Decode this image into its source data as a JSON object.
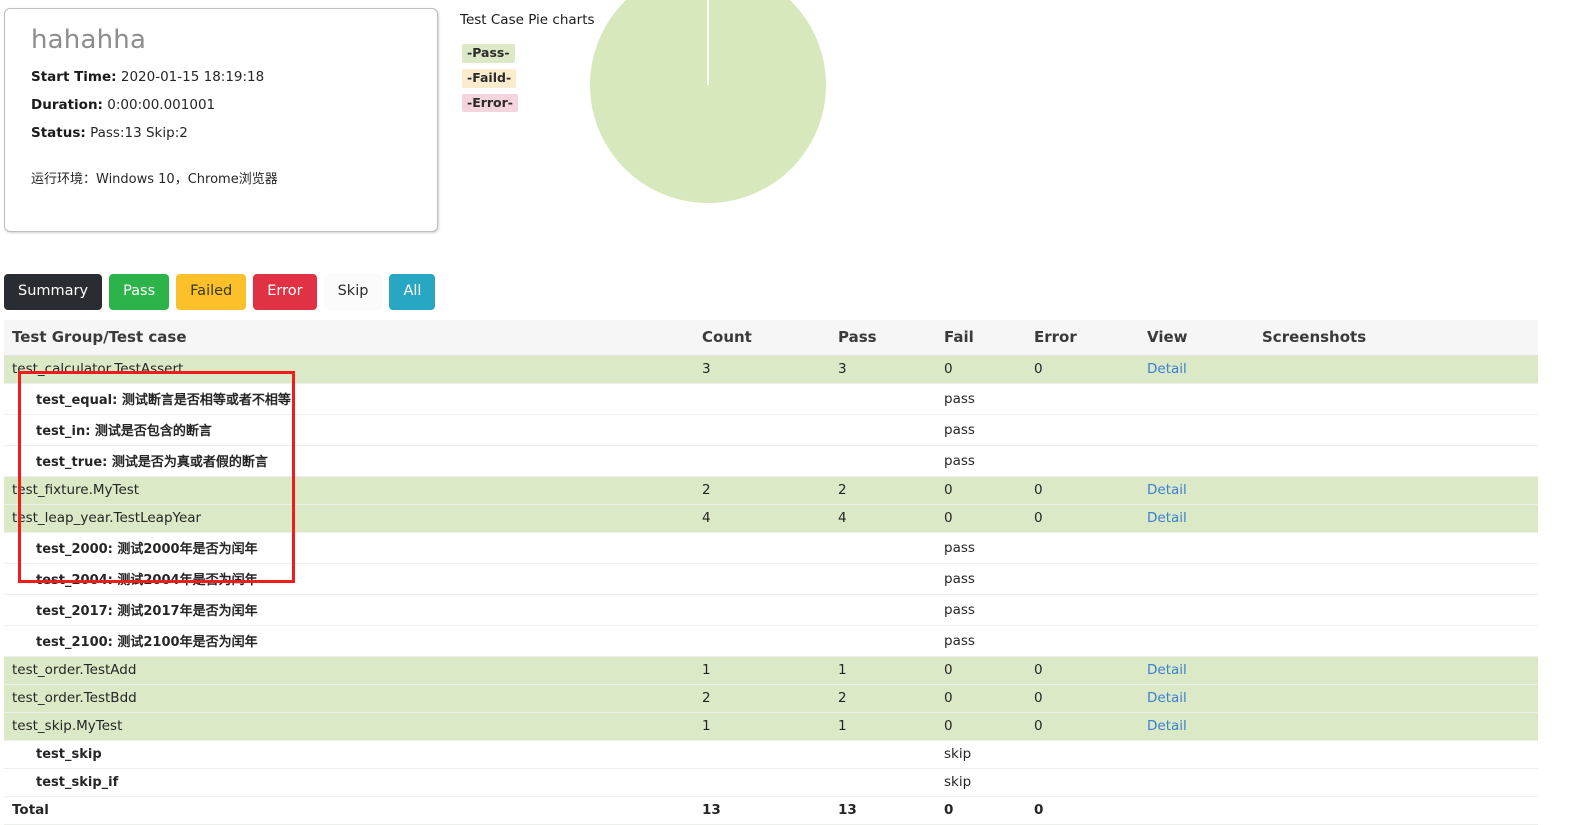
{
  "summary": {
    "title": "hahahha",
    "start_time_label": "Start Time:",
    "start_time_value": "2020-01-15 18:19:18",
    "duration_label": "Duration:",
    "duration_value": "0:00:00.001001",
    "status_label": "Status:",
    "status_value": "Pass:13 Skip:2",
    "environment": "运行环境：Windows 10，Chrome浏览器"
  },
  "pie": {
    "title": "Test Case Pie charts",
    "legend": [
      {
        "label": "-Pass-",
        "bg": "#dbe9c6",
        "fg": "#2b2b2b"
      },
      {
        "label": "-Faild-",
        "bg": "#fbeccd",
        "fg": "#2b2b2b"
      },
      {
        "label": "-Error-",
        "bg": "#f4d4dd",
        "fg": "#2b2b2b"
      }
    ]
  },
  "chart_data": {
    "type": "pie",
    "title": "Test Case Pie charts",
    "labels": [
      "Pass",
      "Faild",
      "Error"
    ],
    "values": [
      13,
      0,
      0
    ],
    "percentages": [
      100,
      0,
      0
    ],
    "colors": [
      "#d6e8bc",
      "#fbeccd",
      "#f4d4dd"
    ],
    "legend": "left",
    "start_angle": 90,
    "slice_divider_color": "#ffffff"
  },
  "filters": [
    {
      "label": "Summary",
      "bg": "#292c31",
      "fg": "#ffffff",
      "border": "#292c31"
    },
    {
      "label": "Pass",
      "bg": "#2cb34a",
      "fg": "#ffffff",
      "border": "#2cb34a"
    },
    {
      "label": "Failed",
      "bg": "#fbc02a",
      "fg": "#3a3a1a",
      "border": "#fbc02a"
    },
    {
      "label": "Error",
      "bg": "#e03145",
      "fg": "#ffffff",
      "border": "#e03145"
    },
    {
      "label": "Skip",
      "bg": "#fbfbfb",
      "fg": "#2b2b2b",
      "border": "#fbfbfb"
    },
    {
      "label": "All",
      "bg": "#28a7c4",
      "fg": "#ffffff",
      "border": "#28a7c4"
    }
  ],
  "table": {
    "columns": [
      "Test Group/Test case",
      "Count",
      "Pass",
      "Fail",
      "Error",
      "View",
      "Screenshots"
    ],
    "detail_label": "Detail",
    "rows": [
      {
        "kind": "group",
        "name": "test_calculator.TestAssert",
        "count": "3",
        "pass": "3",
        "fail": "0",
        "error": "0",
        "view": "Detail",
        "screenshots": ""
      },
      {
        "kind": "case",
        "name": "test_equal: 测试断言是否相等或者不相等",
        "status": "pass",
        "status_kind": "pass"
      },
      {
        "kind": "case",
        "name": "test_in: 测试是否包含的断言",
        "status": "pass",
        "status_kind": "pass"
      },
      {
        "kind": "case",
        "name": "test_true: 测试是否为真或者假的断言",
        "status": "pass",
        "status_kind": "pass"
      },
      {
        "kind": "group",
        "name": "test_fixture.MyTest",
        "count": "2",
        "pass": "2",
        "fail": "0",
        "error": "0",
        "view": "Detail",
        "screenshots": ""
      },
      {
        "kind": "group",
        "name": "test_leap_year.TestLeapYear",
        "count": "4",
        "pass": "4",
        "fail": "0",
        "error": "0",
        "view": "Detail",
        "screenshots": ""
      },
      {
        "kind": "case",
        "name": "test_2000: 测试2000年是否为闰年",
        "status": "pass",
        "status_kind": "pass"
      },
      {
        "kind": "case",
        "name": "test_2004: 测试2004年是否为闰年",
        "status": "pass",
        "status_kind": "pass"
      },
      {
        "kind": "case",
        "name": "test_2017: 测试2017年是否为闰年",
        "status": "pass",
        "status_kind": "pass"
      },
      {
        "kind": "case",
        "name": "test_2100: 测试2100年是否为闰年",
        "status": "pass",
        "status_kind": "pass"
      },
      {
        "kind": "group",
        "name": "test_order.TestAdd",
        "count": "1",
        "pass": "1",
        "fail": "0",
        "error": "0",
        "view": "Detail",
        "screenshots": ""
      },
      {
        "kind": "group",
        "name": "test_order.TestBdd",
        "count": "2",
        "pass": "2",
        "fail": "0",
        "error": "0",
        "view": "Detail",
        "screenshots": ""
      },
      {
        "kind": "group",
        "name": "test_skip.MyTest",
        "count": "1",
        "pass": "1",
        "fail": "0",
        "error": "0",
        "view": "Detail",
        "screenshots": ""
      },
      {
        "kind": "case",
        "name": "test_skip",
        "status": "skip",
        "status_kind": "skip"
      },
      {
        "kind": "case",
        "name": "test_skip_if",
        "status": "skip",
        "status_kind": "skip"
      }
    ],
    "total": {
      "name": "Total",
      "count": "13",
      "pass": "13",
      "fail": "0",
      "error": "0",
      "view": "",
      "screenshots": ""
    }
  },
  "annotation": {
    "color": "#ee1c1c"
  }
}
